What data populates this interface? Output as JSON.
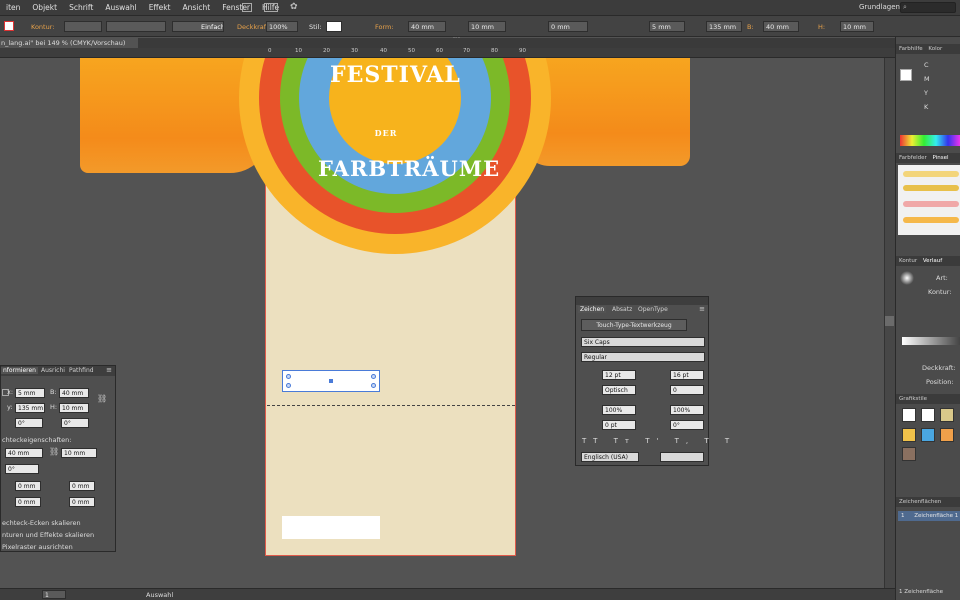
{
  "menubar": {
    "items": [
      "iten",
      "Objekt",
      "Schrift",
      "Auswahl",
      "Effekt",
      "Ansicht",
      "Fenster",
      "Hilfe"
    ],
    "workspace": "Grundlagen",
    "search_placeholder": ""
  },
  "controlbar": {
    "kontur_label": "Kontur:",
    "stroke_style": "Einfach",
    "deckkraft_label": "Deckkraft:",
    "deckkraft_value": "100%",
    "stil_label": "Stil:",
    "form_label": "Form:",
    "width_value": "40 mm",
    "height_value": "10 mm",
    "rotate_value": "0 mm",
    "x_value": "5 mm",
    "y_value": "135 mm",
    "b_label": "B:",
    "b_value": "40 mm",
    "h_label": "H:",
    "h_value": "10 mm"
  },
  "document_tab": {
    "title": "n_lang.ai\" bei 149 % (CMYK/Vorschau)"
  },
  "ruler": {
    "ticks": [
      "0",
      "10",
      "20",
      "30",
      "40",
      "50",
      "60",
      "70",
      "80",
      "90"
    ]
  },
  "artwork": {
    "title_line1": "FESTIVAL",
    "title_line2": "DER",
    "title_line3": "FARBTRÄUME"
  },
  "colors": {
    "accent_orange": "#e8a24a",
    "selection_blue": "#4a7bd8",
    "artboard_bg": "#ece0bf",
    "artboard_border": "#e05a4a"
  },
  "transform_panel": {
    "tabs": [
      "nformieren",
      "Ausrichi",
      "Pathfind"
    ],
    "x_label": "x:",
    "x_value": "5 mm",
    "y_label": "y:",
    "y_value": "135 mm",
    "b_label": "B:",
    "b_value": "40 mm",
    "h_label": "H:",
    "h_value": "10 mm",
    "angle_value": "0°",
    "shear_value": "0°",
    "rect_props_label": "chteckeigenschaften:",
    "rect_w": "40 mm",
    "rect_h": "10 mm",
    "rect_angle": "0°",
    "corner_values": [
      "0 mm",
      "0 mm",
      "0 mm",
      "0 mm"
    ],
    "options": [
      "echteck-Ecken skalieren",
      "nturen und Effekte skalieren",
      "Pixelraster ausrichten"
    ]
  },
  "character_panel": {
    "tabs": [
      "Zeichen",
      "Absatz",
      "OpenType"
    ],
    "touch_button": "Touch-Type-Textwerkzeug",
    "font_family": "Six Caps",
    "font_style": "Regular",
    "font_size": "12 pt",
    "leading": "16 pt",
    "kerning": "Optisch",
    "tracking": "0",
    "vscale": "100%",
    "hscale": "100%",
    "baseline": "0 pt",
    "rotation": "0°",
    "language": "Englisch (USA)"
  },
  "right_panel": {
    "color_tabs": [
      "Farbhilfe",
      "Kolor"
    ],
    "color_channels": [
      "C",
      "M",
      "Y",
      "K"
    ],
    "brush_tabs": [
      "Farbfelder",
      "Pinsel"
    ],
    "appearance_tabs": [
      "Kontur",
      "Verlauf"
    ],
    "art_label": "Art:",
    "kontur_label": "Kontur:",
    "deckkraft_label": "Deckkraft:",
    "position_label": "Position:",
    "graphic_styles_title": "Grafikstile",
    "artboards_title": "Zeichenflächen",
    "artboard_index": "1",
    "artboard_name": "Zeichenfläche 1",
    "artboard_count": "1 Zeichenfläche"
  },
  "statusbar": {
    "zoom": "1",
    "tool": "Auswahl"
  }
}
